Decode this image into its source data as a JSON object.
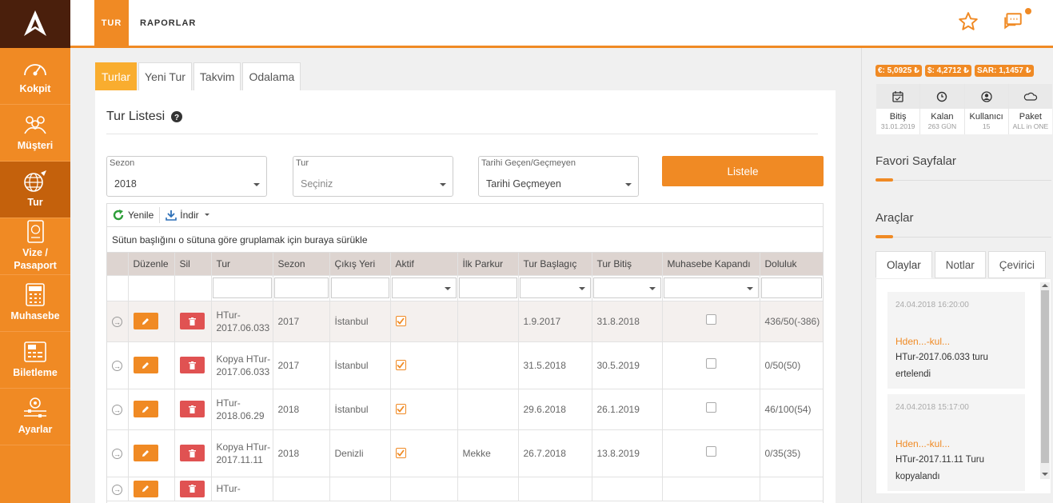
{
  "sidebar": {
    "items": [
      {
        "label": "Kokpit"
      },
      {
        "label": "Müşteri"
      },
      {
        "label": "Tur"
      },
      {
        "label": "Vize /\nPasaport"
      },
      {
        "label": "Muhasebe"
      },
      {
        "label": "Biletleme"
      },
      {
        "label": "Ayarlar"
      }
    ]
  },
  "topbar": {
    "tabs": [
      "TUR",
      "RAPORLAR"
    ]
  },
  "subtabs": [
    "Turlar",
    "Yeni Tur",
    "Takvim",
    "Odalama"
  ],
  "panel": {
    "title": "Tur Listesi"
  },
  "filters": {
    "sezon": {
      "label": "Sezon",
      "value": "2018"
    },
    "tur": {
      "label": "Tur",
      "value": "Seçiniz"
    },
    "tarih": {
      "label": "Tarihi Geçen/Geçmeyen",
      "value": "Tarihi Geçmeyen"
    }
  },
  "list_button": "Listele",
  "toolbar": {
    "refresh": "Yenile",
    "download": "İndir"
  },
  "group_hint": "Sütun başlığını o sütuna göre gruplamak için buraya sürükle",
  "columns": [
    "Düzenle",
    "Sil",
    "Tur",
    "Sezon",
    "Çıkış Yeri",
    "Aktif",
    "İlk Parkur",
    "Tur Başlagıç",
    "Tur Bitiş",
    "Muhasebe Kapandı",
    "Doluluk"
  ],
  "rows": [
    {
      "tur": "HTur-2017.06.033",
      "sezon": "2017",
      "cikis": "İstanbul",
      "aktif": true,
      "parkur": "",
      "baslangic": "1.9.2017",
      "bitis": "31.8.2018",
      "kapandi": false,
      "doluluk": "436/50(-386)"
    },
    {
      "tur": "Kopya HTur-2017.06.033",
      "sezon": "2017",
      "cikis": "İstanbul",
      "aktif": true,
      "parkur": "",
      "baslangic": "31.5.2018",
      "bitis": "30.5.2019",
      "kapandi": false,
      "doluluk": "0/50(50)"
    },
    {
      "tur": "HTur-2018.06.29",
      "sezon": "2018",
      "cikis": "İstanbul",
      "aktif": true,
      "parkur": "",
      "baslangic": "29.6.2018",
      "bitis": "26.1.2019",
      "kapandi": false,
      "doluluk": "46/100(54)"
    },
    {
      "tur": "Kopya HTur-2017.11.11",
      "sezon": "2018",
      "cikis": "Denizli",
      "aktif": true,
      "parkur": "Mekke",
      "baslangic": "26.7.2018",
      "bitis": "13.8.2019",
      "kapandi": false,
      "doluluk": "0/35(35)"
    },
    {
      "tur": "HTur-",
      "sezon": "",
      "cikis": "",
      "aktif": false,
      "parkur": "",
      "baslangic": "",
      "bitis": "",
      "kapandi": false,
      "doluluk": ""
    }
  ],
  "currency": [
    "€: 5,0925 ₺",
    "$: 4,2712 ₺",
    "SAR: 1,1457 ₺"
  ],
  "stats": [
    {
      "title": "Bitiş",
      "sub": "31.01.2019"
    },
    {
      "title": "Kalan",
      "sub": "263 GÜN"
    },
    {
      "title": "Kullanıcı",
      "sub": "15"
    },
    {
      "title": "Paket",
      "sub": "ALL in ONE"
    }
  ],
  "favorites_title": "Favori Sayfalar",
  "tools_title": "Araçlar",
  "right_tabs": [
    "Olaylar",
    "Notlar",
    "Çevirici"
  ],
  "events": [
    {
      "time": "24.04.2018 16:20:00",
      "user": "Hden...-kul...",
      "message": "HTur-2017.06.033 turu ertelendi"
    },
    {
      "time": "24.04.2018 15:17:00",
      "user": "Hden...-kul...",
      "message": "HTur-2017.11.11 Turu kopyalandı"
    }
  ],
  "colors": {
    "accent": "#f08a24",
    "dark": "#4a1f0c",
    "active_nav": "#c4610c",
    "danger": "#e05252",
    "tab_active": "#f9ad2f"
  }
}
